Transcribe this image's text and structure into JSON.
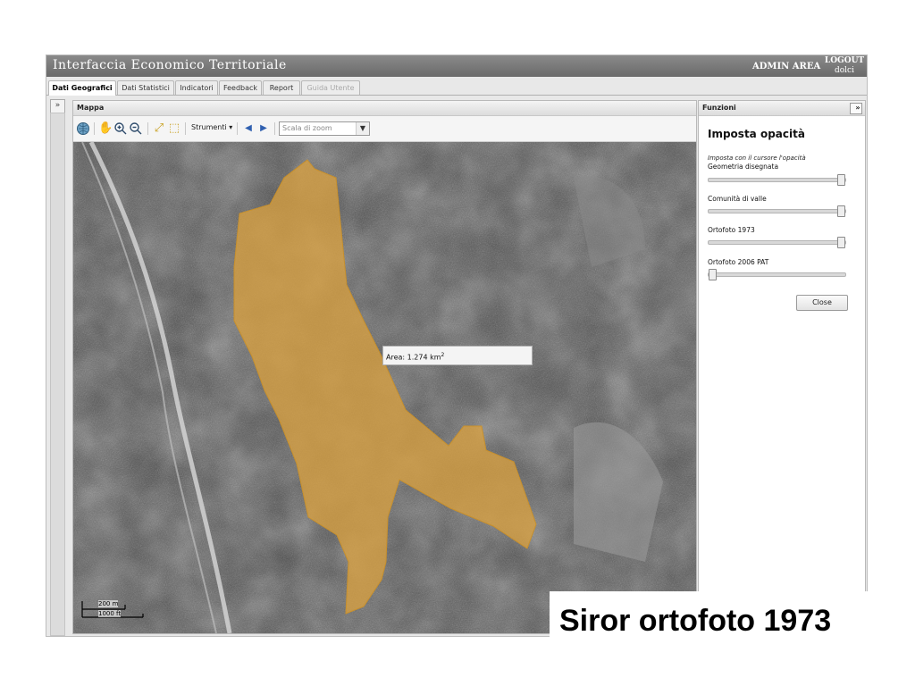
{
  "header": {
    "title": "Interfaccia Economico Territoriale",
    "admin_label": "ADMIN AREA",
    "logout_label": "LOGOUT",
    "username": "dolci"
  },
  "tabs": [
    {
      "label": "Dati Geografici",
      "active": true
    },
    {
      "label": "Dati Statistici"
    },
    {
      "label": "Indicatori"
    },
    {
      "label": "Feedback"
    },
    {
      "label": "Report"
    },
    {
      "label": "Guida Utente",
      "disabled": true
    }
  ],
  "map_panel": {
    "title": "Mappa",
    "toolbar": {
      "strumenti_label": "Strumenti",
      "zoom_placeholder": "Scala di zoom"
    },
    "area_label": "Area: 1.274 km",
    "area_unit_sup": "2",
    "scale": {
      "m": "200 m",
      "ft": "1000 ft"
    }
  },
  "funzioni": {
    "panel_title": "Funzioni",
    "title": "Imposta opacità",
    "hint": "Imposta con il cursore l'opacità",
    "sliders": [
      {
        "label": "Geometria disegnata",
        "value": 1.0
      },
      {
        "label": "Comunità di valle",
        "value": 1.0
      },
      {
        "label": "Ortofoto 1973",
        "value": 1.0
      },
      {
        "label": "Ortofoto 2006 PAT",
        "value": 0.0
      }
    ],
    "close_label": "Close"
  },
  "caption": "Siror ortofoto 1973",
  "colors": {
    "polygon": "#d8a040",
    "titlebar": "#7a7a7a"
  }
}
